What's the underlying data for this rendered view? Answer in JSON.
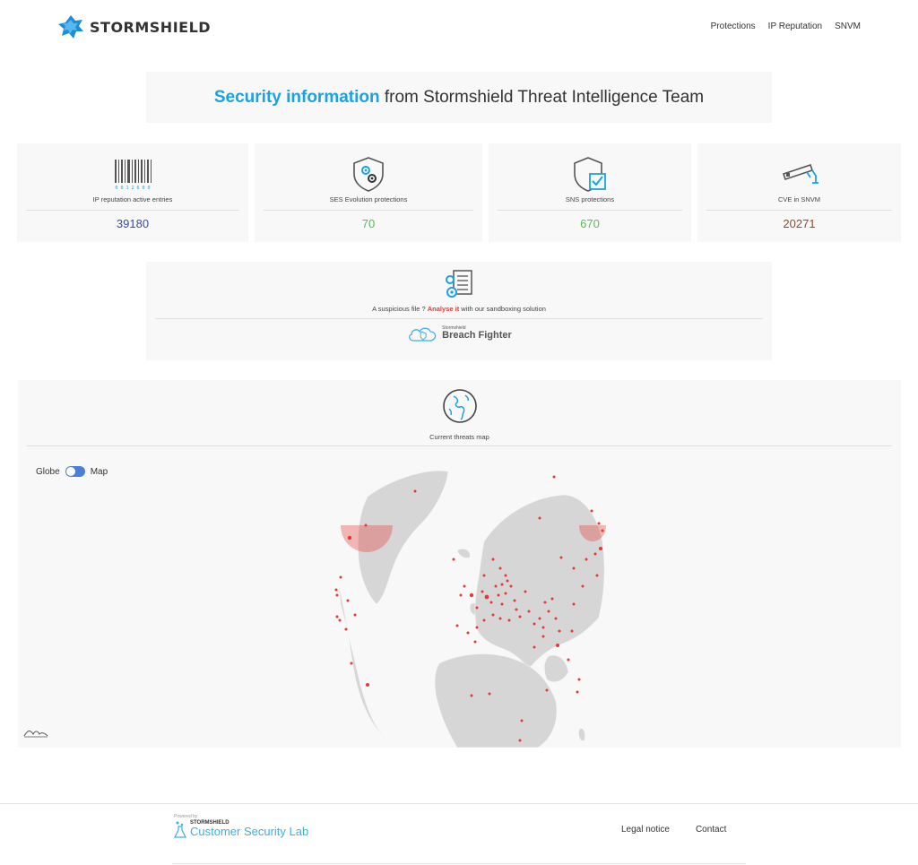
{
  "header": {
    "brand": "STORMSHIELD",
    "nav": [
      "Protections",
      "IP Reputation",
      "SNVM"
    ]
  },
  "banner": {
    "strong": "Security information",
    "rest": " from Stormshield Threat Intelligence Team"
  },
  "stats": [
    {
      "label": "IP reputation active entries",
      "value": "39180",
      "color": "#3b4a9e",
      "icon": "barcode-icon",
      "barcode_digits": "0 0 1 2 6 0 0"
    },
    {
      "label": "SES Evolution protections",
      "value": "70",
      "color": "#5cb85c",
      "icon": "shield-gears-icon"
    },
    {
      "label": "SNS protections",
      "value": "670",
      "color": "#5cb85c",
      "icon": "shield-check-icon"
    },
    {
      "label": "CVE in SNVM",
      "value": "20271",
      "color": "#8b4a2b",
      "icon": "camera-icon"
    }
  ],
  "sandbox": {
    "prefix": "A suspicious file ? ",
    "link": "Analyse it",
    "suffix": " with our sandboxing solution",
    "product_small": "Stormshield",
    "product_big": "Breach Fighter"
  },
  "threats_map": {
    "title": "Current threats map",
    "toggle_left": "Globe",
    "toggle_right": "Map",
    "mode": "Map",
    "marker_color": "#e53935"
  },
  "footer": {
    "powered": "Powered by",
    "brand": "STORMSHIELD",
    "lab": "Customer Security Lab",
    "links": [
      "Legal notice",
      "Contact"
    ]
  },
  "colors": {
    "accent": "#1ca1e2",
    "card_bg": "#f8f8f8"
  }
}
